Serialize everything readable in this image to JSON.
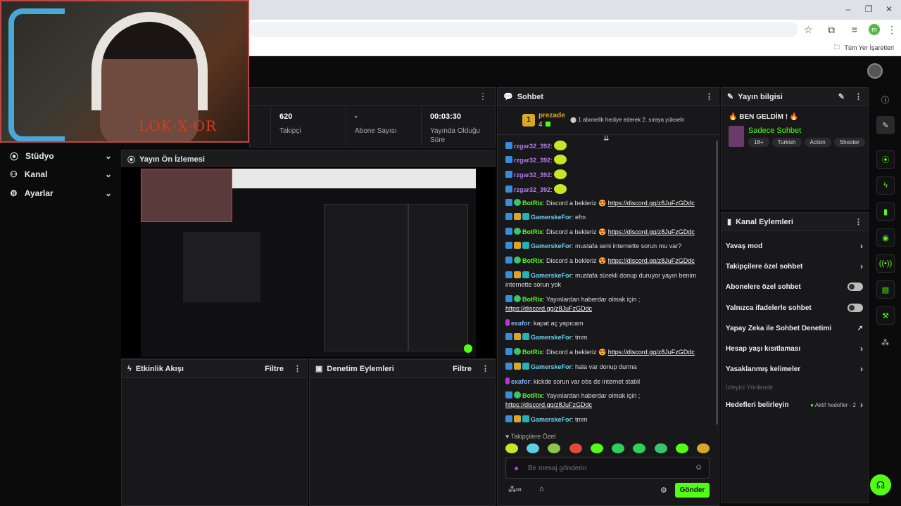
{
  "browser": {
    "bookmarks_label": "Tüm Yer İşaretleri",
    "profile_initial": "m"
  },
  "webcam": {
    "overlay_text": "LOK·X·OR"
  },
  "nav": {
    "items": [
      {
        "label": "Stüdyo",
        "icon": "studio-icon"
      },
      {
        "label": "Kanal",
        "icon": "channel-icon"
      },
      {
        "label": "Ayarlar",
        "icon": "gear-icon"
      }
    ]
  },
  "stats": [
    {
      "value": "620",
      "label": "Takipçi"
    },
    {
      "value": "-",
      "label": "Abone Sayısı"
    },
    {
      "value": "00:03:30",
      "label": "Yayında Olduğu Süre"
    }
  ],
  "preview": {
    "title": "Yayın Ön İzlemesi"
  },
  "activity": {
    "title": "Etkinlik Akışı",
    "filter": "Filtre"
  },
  "moderation": {
    "title": "Denetim Eylemleri",
    "filter": "Filtre"
  },
  "chat": {
    "title": "Sohbet",
    "top_gifter": {
      "rank": "1",
      "name": "prezade",
      "count": "4"
    },
    "gift_hint": "1 abonelik hediye ederek 2. sıraya yükseln",
    "messages": [
      {
        "user": "rzgar32_392",
        "color": "purple",
        "badges": [
          "blue"
        ],
        "text": "",
        "emote": true
      },
      {
        "user": "rzgar32_392",
        "color": "purple",
        "badges": [
          "blue"
        ],
        "text": "",
        "emote": true
      },
      {
        "user": "rzgar32_392",
        "color": "purple",
        "badges": [
          "blue"
        ],
        "text": "",
        "emote": true
      },
      {
        "user": "rzgar32_392",
        "color": "purple",
        "badges": [
          "blue"
        ],
        "text": "",
        "emote": true
      },
      {
        "user": "BotRix",
        "color": "green",
        "badges": [
          "blue",
          "green"
        ],
        "text": "Discord a bekleriz 😍 ",
        "link": "https://discord.gg/z8JuFzGDdc"
      },
      {
        "user": "GamerskeFor",
        "color": "cyan",
        "badges": [
          "blue",
          "gold",
          "teal"
        ],
        "text": "efm"
      },
      {
        "user": "BotRix",
        "color": "green",
        "badges": [
          "blue",
          "green"
        ],
        "text": "Discord a bekleriz 😍 ",
        "link": "https://discord.gg/z8JuFzGDdc"
      },
      {
        "user": "GamerskeFor",
        "color": "cyan",
        "badges": [
          "blue",
          "gold",
          "teal"
        ],
        "text": "mustafa seni internette sorun mu var?"
      },
      {
        "user": "BotRix",
        "color": "green",
        "badges": [
          "blue",
          "green"
        ],
        "text": "Discord a bekleriz 😍 ",
        "link": "https://discord.gg/z8JuFzGDdc"
      },
      {
        "user": "GamerskeFor",
        "color": "cyan",
        "badges": [
          "blue",
          "gold",
          "teal"
        ],
        "text": "mustafa sürekli donup duruyor yayın benim internette sorun yok"
      },
      {
        "user": "BotRix",
        "color": "green",
        "badges": [
          "blue",
          "green"
        ],
        "text": "Yayınlardan haberdar olmak için ; ",
        "link": "https://discord.gg/z8JuFzGDdc"
      },
      {
        "user": "exafor",
        "color": "blue",
        "badges": [
          "mic"
        ],
        "text": "kapat aç yapıcam"
      },
      {
        "user": "GamerskeFor",
        "color": "cyan",
        "badges": [
          "blue",
          "gold",
          "teal"
        ],
        "text": "tmm"
      },
      {
        "user": "BotRix",
        "color": "green",
        "badges": [
          "blue",
          "green"
        ],
        "text": "Discord a bekleriz 😍 ",
        "link": "https://discord.gg/z8JuFzGDdc"
      },
      {
        "user": "GamerskeFor",
        "color": "cyan",
        "badges": [
          "blue",
          "gold",
          "teal"
        ],
        "text": "hala var donup durma"
      },
      {
        "user": "exafor",
        "color": "blue",
        "badges": [
          "mic"
        ],
        "text": "kickde sorun var obs de internet stabil"
      },
      {
        "user": "BotRix",
        "color": "green",
        "badges": [
          "blue",
          "green"
        ],
        "text": "Yayınlardan haberdar olmak için ; ",
        "link": "https://discord.gg/z8JuFzGDdc"
      },
      {
        "user": "GamerskeFor",
        "color": "cyan",
        "badges": [
          "blue",
          "gold",
          "teal"
        ],
        "text": "tmm"
      }
    ],
    "followers_only_label": "Takipçilere Özel",
    "input_placeholder": "Bir mesaj gönderin",
    "send_label": "Gönder"
  },
  "stream_info": {
    "title_header": "Yayın bilgisi",
    "stream_title": "🔥 BEN GELDİM ! 🔥",
    "category": "Sadece Sohbet",
    "tags": [
      "18+",
      "Turkish",
      "Action",
      "Shooter"
    ]
  },
  "channel_actions": {
    "title": "Kanal Eylemleri",
    "rows": [
      {
        "label": "Yavaş mod",
        "control": "chevron"
      },
      {
        "label": "Takipçilere özel sohbet",
        "control": "chevron"
      },
      {
        "label": "Abonelere özel sohbet",
        "control": "toggle"
      },
      {
        "label": "Yalnızca ifadelerle sohbet",
        "control": "toggle"
      },
      {
        "label": "Yapay Zeka ile Sohbet Denetimi",
        "control": "external"
      },
      {
        "label": "Hesap yaşı kısıtlaması",
        "control": "chevron"
      },
      {
        "label": "Yasaklanmış kelimeler",
        "control": "chevron"
      }
    ],
    "disabled_label": "İzleyici Yönlendir",
    "goals_label": "Hedefleri belirleyin",
    "goals_status": "Aktif hedefler - 2"
  },
  "colors": {
    "accent": "#53fc18",
    "panel": "#18181a",
    "background": "#0b0b0c"
  }
}
